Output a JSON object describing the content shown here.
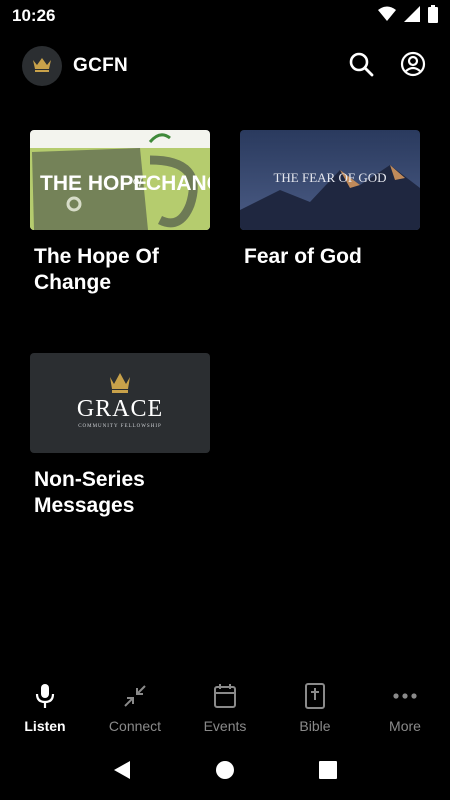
{
  "status_bar": {
    "time": "10:26",
    "icons": [
      "wifi-icon",
      "cell-signal-icon",
      "battery-icon"
    ]
  },
  "app_bar": {
    "title": "GCFN",
    "logo_icon": "crown-icon",
    "actions": [
      "search-icon",
      "account-icon"
    ]
  },
  "series": [
    {
      "title": "The Hope Of Change",
      "thumb_text": [
        "THE HOPE",
        "of",
        "CHANGE"
      ]
    },
    {
      "title": "Fear of God",
      "thumb_text": [
        "THE FEAR OF GOD"
      ]
    },
    {
      "title": "Non-Series Messages",
      "thumb_text": [
        "GRACE",
        "COMMUNITY FELLOWSHIP"
      ]
    }
  ],
  "nav": {
    "items": [
      {
        "label": "Listen",
        "icon": "microphone-icon",
        "active": true
      },
      {
        "label": "Connect",
        "icon": "collapse-arrows-icon",
        "active": false
      },
      {
        "label": "Events",
        "icon": "calendar-icon",
        "active": false
      },
      {
        "label": "Bible",
        "icon": "bible-icon",
        "active": false
      },
      {
        "label": "More",
        "icon": "more-dots-icon",
        "active": false
      }
    ]
  },
  "colors": {
    "background": "#000000",
    "active": "#ffffff",
    "inactive": "#8a8a8a",
    "hope_green": "#b5cc6e",
    "grace_bg": "#2b2e31",
    "crown_gold": "#c9a24a"
  }
}
